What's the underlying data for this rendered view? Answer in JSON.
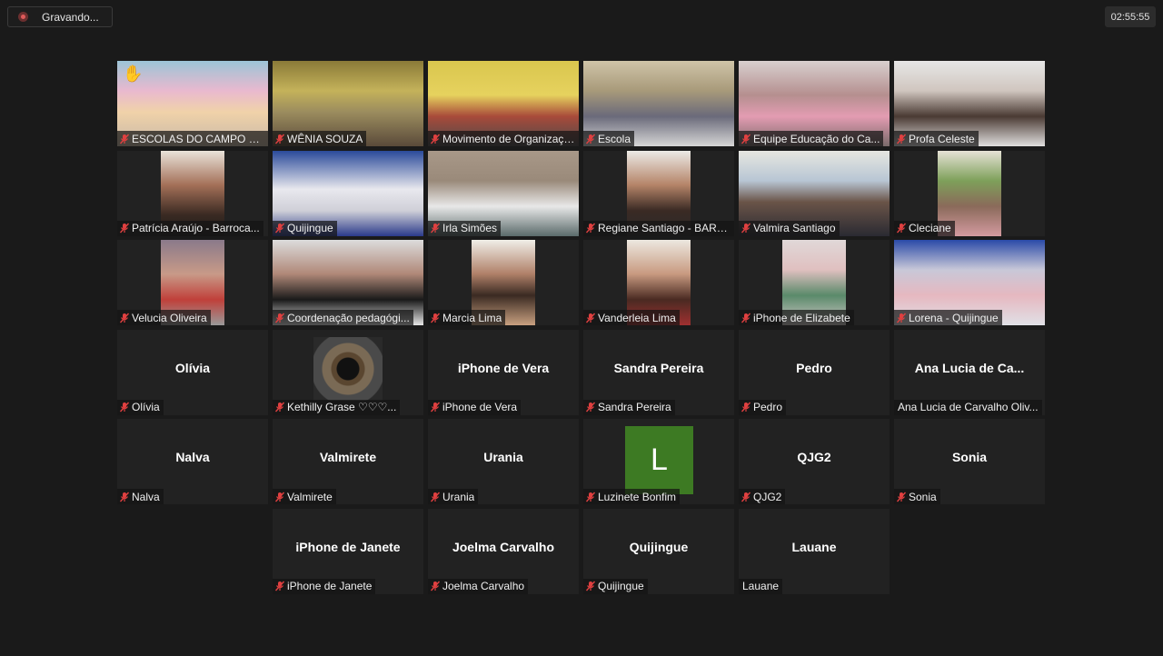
{
  "recording": {
    "label": "Gravando..."
  },
  "timer": "02:55:55",
  "participants": [
    {
      "name": "ESCOLAS DO CAMPO N...",
      "video": "linear-gradient(180deg,#9cc4d6 0%,#e9b9cf 35%,#f0d2a9 60%,#c9b8a6 100%)",
      "hand": true
    },
    {
      "name": "WÊNIA SOUZA",
      "video": "linear-gradient(180deg,#8a7a38 0%,#c4b25a 35%,#9b8c5e 60%,#5a4a3a 100%)"
    },
    {
      "name": "Movimento de Organizaçã...",
      "video": "linear-gradient(180deg,#d9c64e 0%,#e6d25e 40%,#a84a3a 65%,#4a4a4a 100%)",
      "active": true
    },
    {
      "name": "Escola",
      "video": "linear-gradient(180deg,#cfc4a8 0%,#a89a7a 35%,#6a6a7a 65%,#d6d6d6 100%)"
    },
    {
      "name": "Equipe Educação do Ca...",
      "video": "linear-gradient(180deg,#d8d0cf 0%,#b58f8f 40%,#e39cb2 65%,#7a6a6a 100%)"
    },
    {
      "name": "Profa Celeste",
      "video": "linear-gradient(180deg,#e6e6e6 0%,#d0c6bf 35%,#4a3a33 65%,#e0dede 100%)"
    },
    {
      "name": "Patrícia Araújo - Barroca...",
      "center": true,
      "video": "linear-gradient(180deg,#e9e3da 0%,#a47058 40%,#3a2a22 75%,#1c1c1c 100%)"
    },
    {
      "name": "Quijingue",
      "video": "linear-gradient(180deg,#2a4a9a 0%,#e8e8ee 45%,#d0d0d8 70%,#2a3a8a 100%)"
    },
    {
      "name": "Irla Simões",
      "video": "linear-gradient(180deg,#a89888 0%,#9a8a7a 35%,#e8e8e8 65%,#5a6a6a 100%)"
    },
    {
      "name": "Regiane Santiago - BARR...",
      "center": true,
      "video": "linear-gradient(180deg,#eceae6 0%,#b58468 40%,#3a2a24 70%,#2a2a2a 100%)"
    },
    {
      "name": "Valmira Santiago",
      "video": "linear-gradient(180deg,#e6e6e0 0%,#b8c6d4 35%,#6a5448 60%,#2a2a32 100%)"
    },
    {
      "name": "Cleciane",
      "center": true,
      "video": "linear-gradient(180deg,#e6e2d6 0%,#7ea05a 35%,#8a6a5a 65%,#d49aa0 100%)"
    },
    {
      "name": "Velucia Oliveira",
      "center": true,
      "video": "linear-gradient(180deg,#8a7a8a 0%,#c89a88 40%,#c0403a 70%,#9a9a9a 100%)"
    },
    {
      "name": "Coordenação pedagógi...",
      "video": "linear-gradient(180deg,#dcdcdc 0%,#b08878 40%,#1a1a1a 70%,#e6e6e6 100%)"
    },
    {
      "name": "Marcia Lima",
      "center": true,
      "video": "linear-gradient(180deg,#f0eee8 0%,#b08068 40%,#3a2a22 65%,#c8a080 100%)"
    },
    {
      "name": "Vanderleia Lima",
      "center": true,
      "video": "linear-gradient(180deg,#ece8e0 0%,#c89a80 40%,#4a2a22 70%,#a03030 100%)"
    },
    {
      "name": "iPhone de Elizabete",
      "center": true,
      "video": "linear-gradient(180deg,#e0d8d8 0%,#e0c0c0 35%,#5a8a6a 65%,#d0c8c8 100%)"
    },
    {
      "name": "Lorena - Quijingue",
      "video": "linear-gradient(180deg,#2a4aa8 0%,#c8c8d8 35%,#e6b8c0 65%,#e0e0e6 100%)"
    },
    {
      "name": "Olívia",
      "display": "Olívia"
    },
    {
      "name": "Kethilly Grase ♡♡♡...",
      "eye": true
    },
    {
      "name": "iPhone de Vera",
      "display": "iPhone de Vera"
    },
    {
      "name": "Sandra Pereira",
      "display": "Sandra Pereira"
    },
    {
      "name": "Pedro",
      "display": "Pedro"
    },
    {
      "name": "Ana Lucia de Carvalho Oliv...",
      "display": "Ana Lucia de Ca...",
      "nomute": true
    },
    {
      "name": "Nalva",
      "display": "Nalva"
    },
    {
      "name": "Valmirete",
      "display": "Valmirete"
    },
    {
      "name": "Urania",
      "display": "Urania"
    },
    {
      "name": "Luzinete Bonfim",
      "avatar": "L"
    },
    {
      "name": "QJG2",
      "display": "QJG2"
    },
    {
      "name": "Sonia",
      "display": "Sonia"
    },
    {
      "name": "",
      "empty": true
    },
    {
      "name": "iPhone de Janete",
      "display": "iPhone de Janete"
    },
    {
      "name": "Joelma Carvalho",
      "display": "Joelma Carvalho"
    },
    {
      "name": "Quijingue",
      "display": "Quijingue"
    },
    {
      "name": "Lauane",
      "display": "Lauane",
      "nomute": true
    },
    {
      "name": "",
      "empty": true
    }
  ]
}
